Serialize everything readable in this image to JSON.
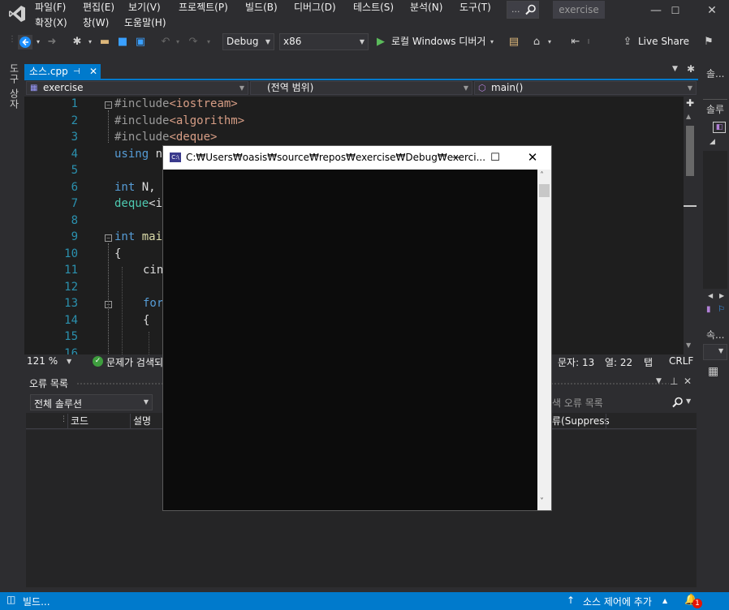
{
  "menu": {
    "row1": [
      "파일(F)",
      "편집(E)",
      "보기(V)",
      "프로젝트(P)",
      "빌드(B)",
      "디버그(D)",
      "테스트(S)",
      "분석(N)",
      "도구(T)"
    ],
    "row2": [
      "확장(X)",
      "창(W)",
      "도움말(H)"
    ],
    "search_placeholder": "...",
    "solution_name": "exercise"
  },
  "toolbar": {
    "config": "Debug",
    "platform": "x86",
    "run_label": "로컬 Windows 디버거",
    "live_share": "Live Share"
  },
  "toolbox_label": "도구 상자",
  "tab": {
    "label": "소스.cpp"
  },
  "navbar": {
    "project": "exercise",
    "scope": "(전역 범위)",
    "member": "main()"
  },
  "editor": {
    "lines": [
      {
        "n": "1"
      },
      {
        "n": "2"
      },
      {
        "n": "3"
      },
      {
        "n": "4"
      },
      {
        "n": "5"
      },
      {
        "n": "6"
      },
      {
        "n": "7"
      },
      {
        "n": "8"
      },
      {
        "n": "9"
      },
      {
        "n": "10"
      },
      {
        "n": "11"
      },
      {
        "n": "12"
      },
      {
        "n": "13"
      },
      {
        "n": "14"
      },
      {
        "n": "15"
      },
      {
        "n": "16"
      }
    ],
    "code": {
      "l1_pp": "#include",
      "l1_inc": "<iostream>",
      "l2_pp": "#include",
      "l2_inc": "<algorithm>",
      "l3_pp": "#include",
      "l3_inc": "<deque>",
      "l4_kw": "using",
      "l4_rest": " n",
      "l6_kw": "int",
      "l6_rest": " N,",
      "l7_ty": "deque",
      "l7_rest": "<i",
      "l9_kw": "int",
      "l9_rest": " mai",
      "l10": "{",
      "l11": "cin",
      "l13_kw": "for",
      "l14": "{"
    }
  },
  "edit_status": {
    "zoom": "121 %",
    "issues": "문제가 검색되",
    "char": "문자: 13",
    "col": "열: 22",
    "tab": "탭",
    "eol": "CRLF"
  },
  "error_list": {
    "title": "오류 목록",
    "scope": "전체 솔루션",
    "search_placeholder": "색 오류 목록",
    "columns": {
      "code": "코드",
      "desc": "설명",
      "suppress": "류(Suppress"
    }
  },
  "right_strip": {
    "item1": "솔...",
    "item2": "솔루",
    "item3": "속..."
  },
  "statusbar": {
    "build": "빌드...",
    "source_control": "소스 제어에 추가",
    "notif_count": "1"
  },
  "console": {
    "title": "C:₩Users₩oasis₩source₩repos₩exercise₩Debug₩exerci...",
    "icon_text": "C:\\"
  },
  "colors": {
    "accent": "#007acc",
    "editor_bg": "#1e1e1e",
    "console_bg": "#0c0c0c"
  }
}
